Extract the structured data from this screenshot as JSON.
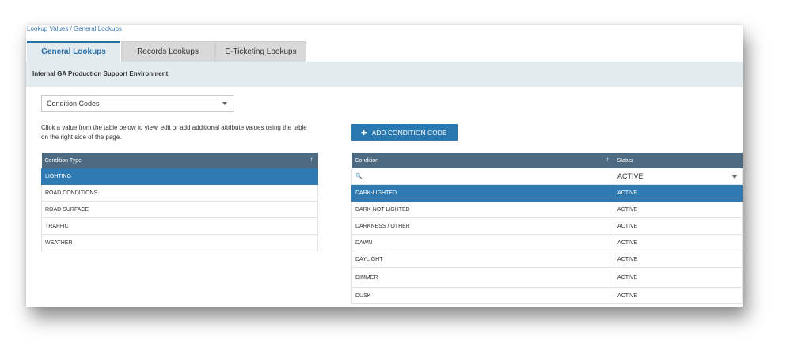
{
  "breadcrumb": "Lookup Values / General Lookups",
  "tabs": [
    {
      "label": "General Lookups",
      "active": true
    },
    {
      "label": "Records Lookups",
      "active": false
    },
    {
      "label": "E-Ticketing Lookups",
      "active": false
    }
  ],
  "environment": "Internal GA Production Support Environment",
  "lookup_select": {
    "value": "Condition Codes"
  },
  "instructions": "Click a value from the table below to view, edit or add additional attribute values using the table on the right side of the page.",
  "add_button": {
    "label": "ADD CONDITION CODE"
  },
  "left_table": {
    "header": "Condition Type",
    "rows": [
      "LIGHTING",
      "ROAD CONDITIONS",
      "ROAD SURFACE",
      "TRAFFIC",
      "WEATHER"
    ],
    "selected": 0
  },
  "right_table": {
    "headers": [
      "Condition",
      "Status"
    ],
    "status_filter": "ACTIVE",
    "rows": [
      {
        "condition": "DARK-LIGHTED",
        "status": "ACTIVE"
      },
      {
        "condition": "DARK-NOT LIGHTED",
        "status": "ACTIVE"
      },
      {
        "condition": "DARKNESS / OTHER",
        "status": "ACTIVE"
      },
      {
        "condition": "DAWN",
        "status": "ACTIVE"
      },
      {
        "condition": "DAYLIGHT",
        "status": "ACTIVE"
      },
      {
        "condition": "DIMMER",
        "status": "ACTIVE"
      },
      {
        "condition": "DUSK",
        "status": "ACTIVE"
      }
    ],
    "selected": 0
  },
  "colors": {
    "accent": "#2a78b0",
    "header_bg": "#4d6a80",
    "env_bar": "#e4ebef"
  }
}
